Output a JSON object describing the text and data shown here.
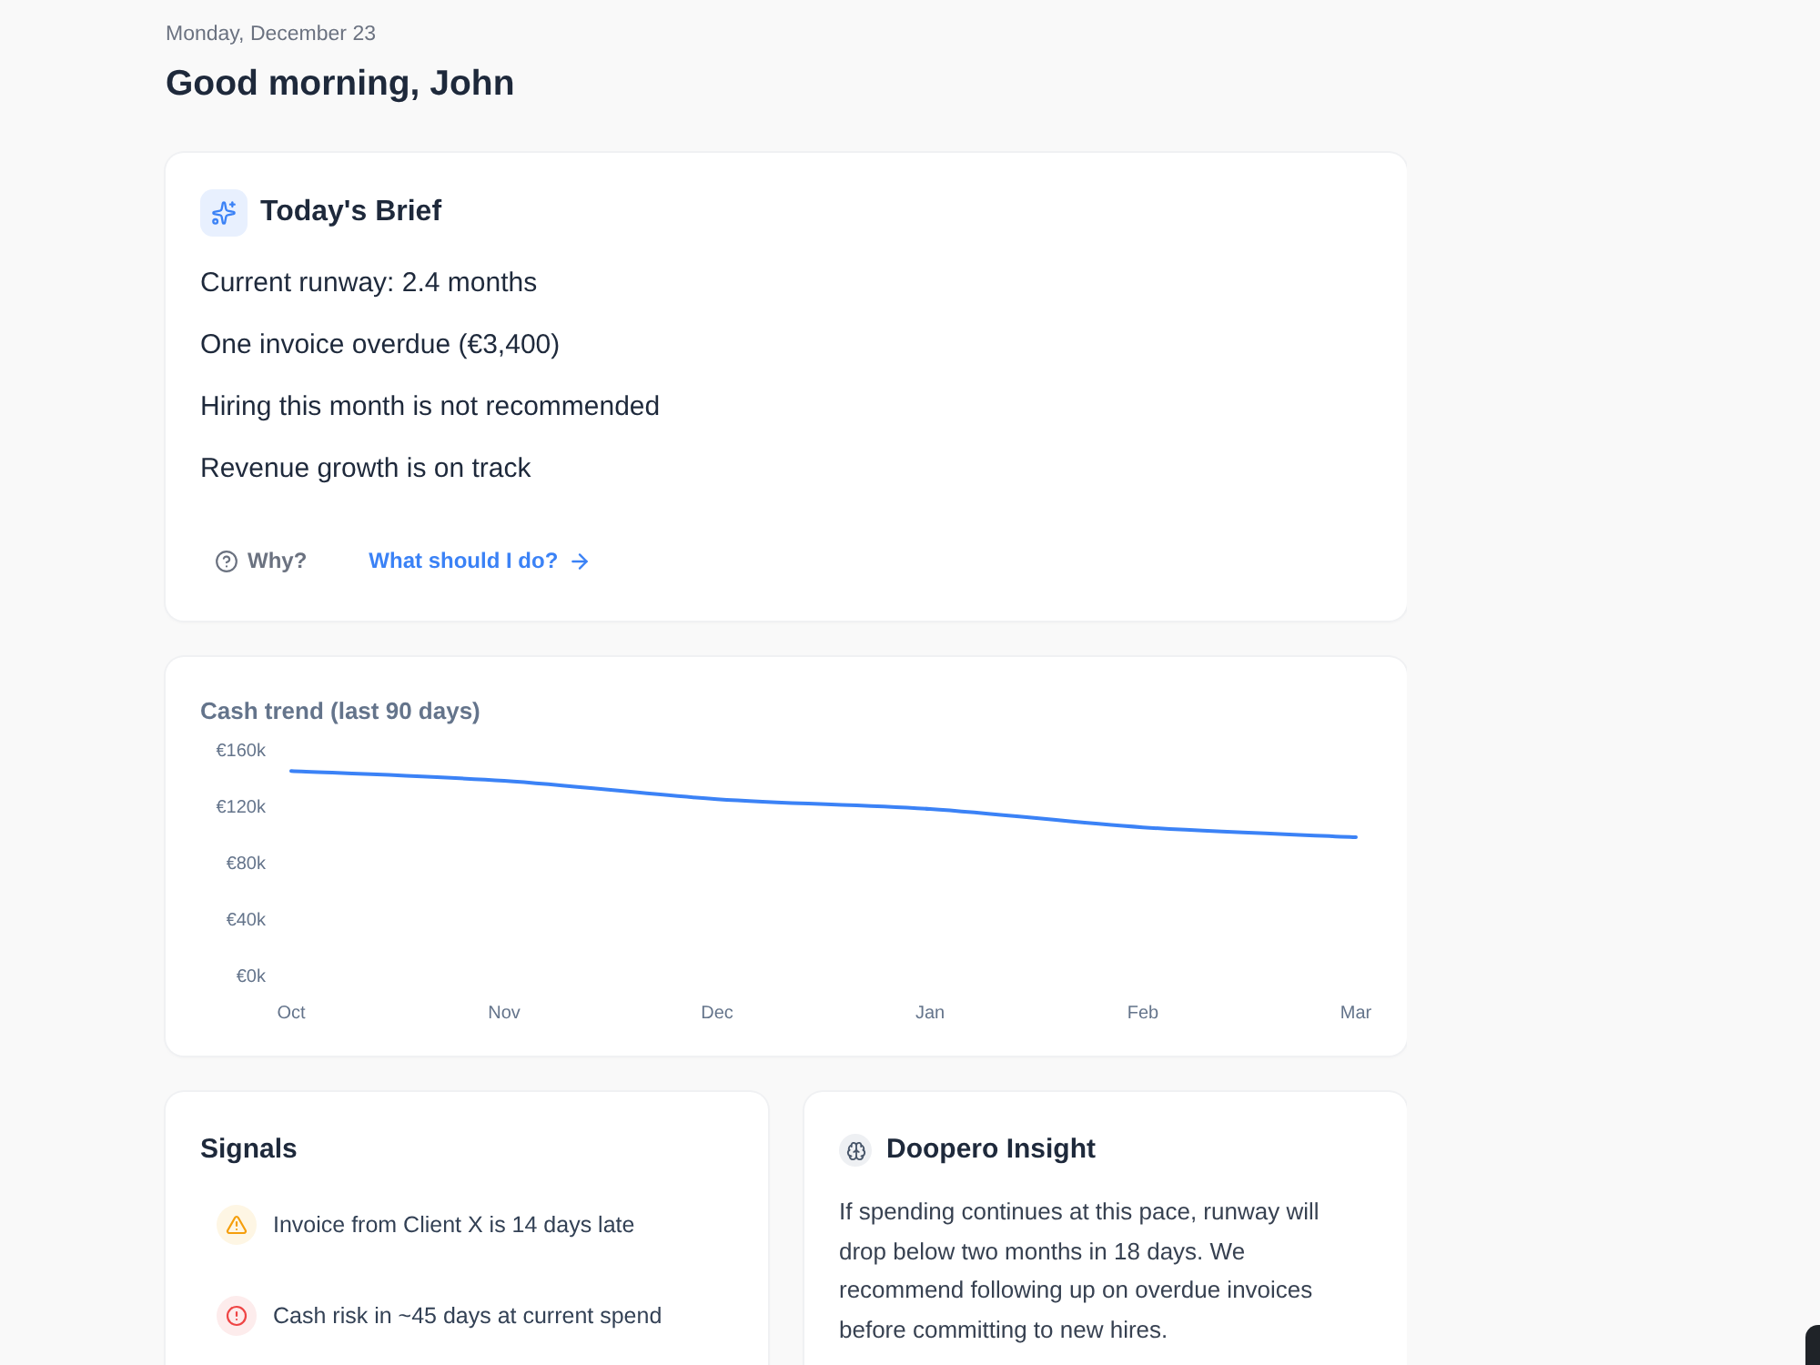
{
  "header": {
    "date": "Monday, December 23",
    "greeting": "Good morning, John"
  },
  "brief": {
    "title": "Today's Brief",
    "items": [
      "Current runway: 2.4 months",
      "One invoice overdue (€3,400)",
      "Hiring this month is not recommended",
      "Revenue growth is on track"
    ],
    "actions": [
      {
        "kind": "help",
        "label": "Why?"
      },
      {
        "kind": "link",
        "label": "What should I do?"
      }
    ]
  },
  "cash_trend": {
    "chart_data": {
      "type": "line",
      "title": "Cash trend (last 90 days)",
      "categories": [
        "Oct",
        "Nov",
        "Dec",
        "Jan",
        "Feb",
        "Mar"
      ],
      "series": [
        {
          "color": "#3b82f6",
          "values": [
            145,
            138,
            125,
            118,
            105,
            98
          ]
        }
      ],
      "ylim": [
        0,
        160
      ],
      "yticks": [
        {
          "value": 0,
          "label": "€0k"
        },
        {
          "value": 40,
          "label": "€40k"
        },
        {
          "value": 80,
          "label": "€80k"
        },
        {
          "value": 120,
          "label": "€120k"
        },
        {
          "value": 160,
          "label": "€160k"
        }
      ]
    }
  },
  "signals": {
    "title": "Signals",
    "items": [
      {
        "kind": "warning",
        "text": "Invoice from Client X is 14 days late"
      },
      {
        "kind": "danger",
        "text": "Cash risk in ~45 days at current spend"
      }
    ]
  },
  "insight": {
    "title": "Doopero Insight",
    "text": "If spending continues at this pace, runway will drop below two months in 18 days. We recommend following up on overdue invoices before committing to new hires."
  }
}
